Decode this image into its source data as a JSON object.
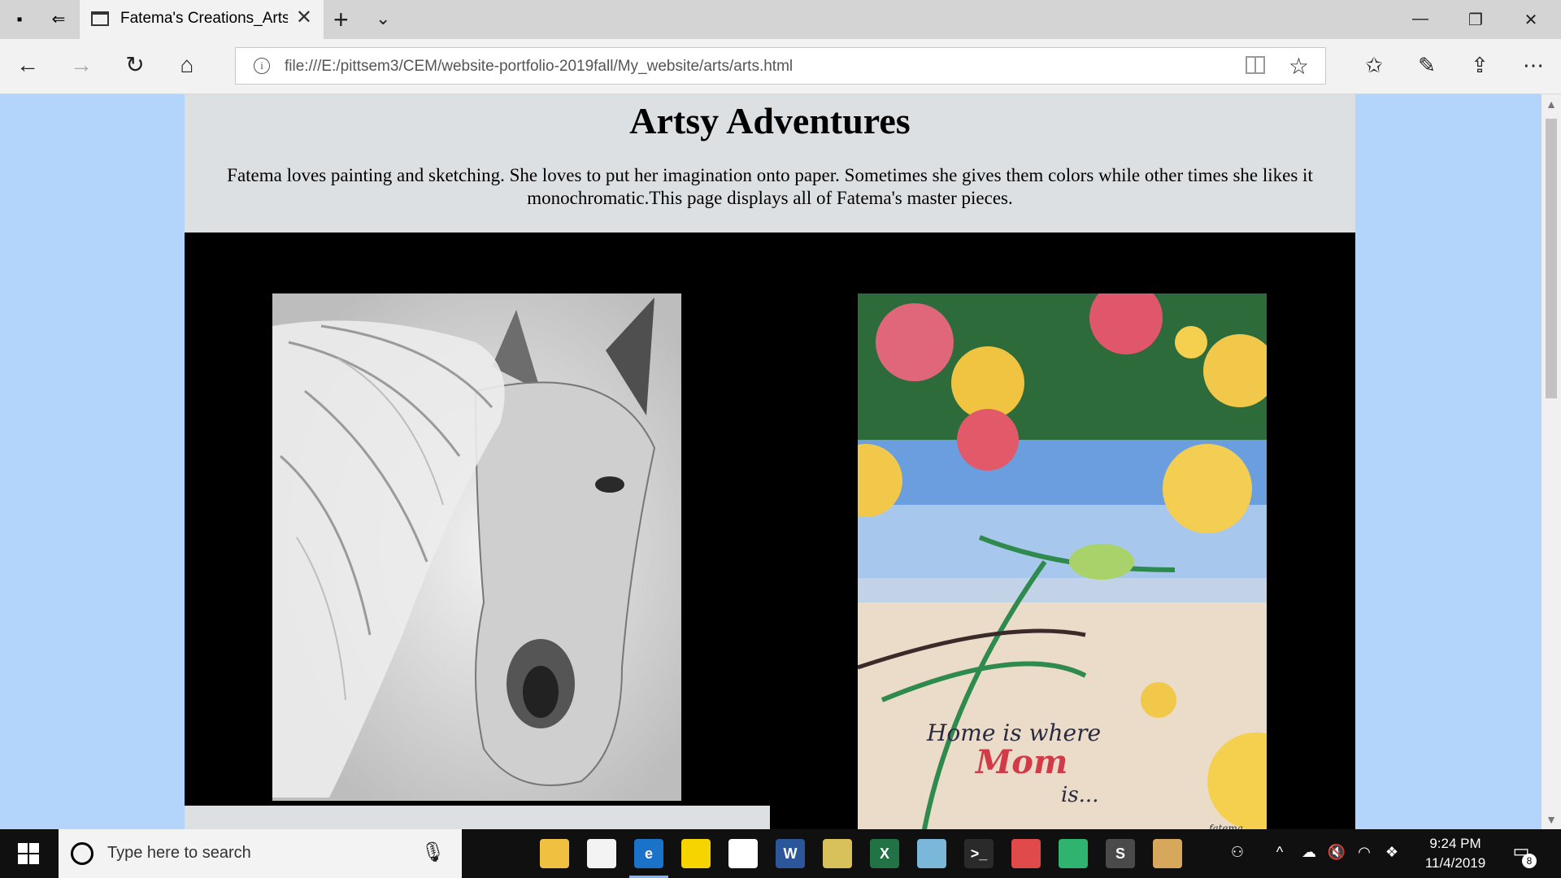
{
  "browser": {
    "tab_title": "Fatema's Creations_Arts",
    "new_tab_symbol": "+",
    "tab_close_symbol": "✕",
    "url": "file:///E:/pittsem3/CEM/website-portfolio-2019fall/My_website/arts/arts.html",
    "nav_icons": [
      "back-icon",
      "forward-icon",
      "refresh-icon",
      "home-icon"
    ],
    "toolbar_icons": [
      "favorites-icon",
      "pen-icon",
      "share-icon",
      "more-icon"
    ],
    "more_label": "⋯"
  },
  "page": {
    "heading": "Artsy Adventures",
    "intro": "Fatema loves painting and sketching. She loves to put her imagination onto paper. Sometimes she gives them colors while other times she likes it monochromatic.This page displays all of Fatema's master pieces.",
    "artworks": [
      {
        "subject": "horse-pencil-sketch"
      },
      {
        "subject": "floral-painting",
        "text_line1": "Home is where",
        "text_line2": "Mom",
        "text_line3": "is...",
        "signature": "fatema"
      }
    ]
  },
  "taskbar": {
    "search_placeholder": "Type here to search",
    "time": "9:24 PM",
    "date": "11/4/2019",
    "notification_count": "8",
    "apps": [
      {
        "name": "task-view-icon",
        "letter": "",
        "color": "#101010"
      },
      {
        "name": "file-explorer-icon",
        "letter": "",
        "color": "#f0c040"
      },
      {
        "name": "store-icon",
        "letter": "",
        "color": "#f3f3f3"
      },
      {
        "name": "edge-icon",
        "letter": "e",
        "color": "#1a73c8"
      },
      {
        "name": "sticky-notes-icon",
        "letter": "",
        "color": "#f5d400"
      },
      {
        "name": "chrome-icon",
        "letter": "",
        "color": "#ffffff"
      },
      {
        "name": "word-icon",
        "letter": "W",
        "color": "#2b579a"
      },
      {
        "name": "app-icon",
        "letter": "",
        "color": "#d8c15a"
      },
      {
        "name": "excel-icon",
        "letter": "X",
        "color": "#217346"
      },
      {
        "name": "prism-icon",
        "letter": "",
        "color": "#7ab7d8"
      },
      {
        "name": "terminal-icon",
        "letter": ">_",
        "color": "#2a2a2a"
      },
      {
        "name": "snipping-icon",
        "letter": "",
        "color": "#e04a4a"
      },
      {
        "name": "atom-icon",
        "letter": "",
        "color": "#2fb36f"
      },
      {
        "name": "sublime-icon",
        "letter": "S",
        "color": "#4a4a4a"
      },
      {
        "name": "paint-icon",
        "letter": "",
        "color": "#d7a85c"
      }
    ]
  }
}
